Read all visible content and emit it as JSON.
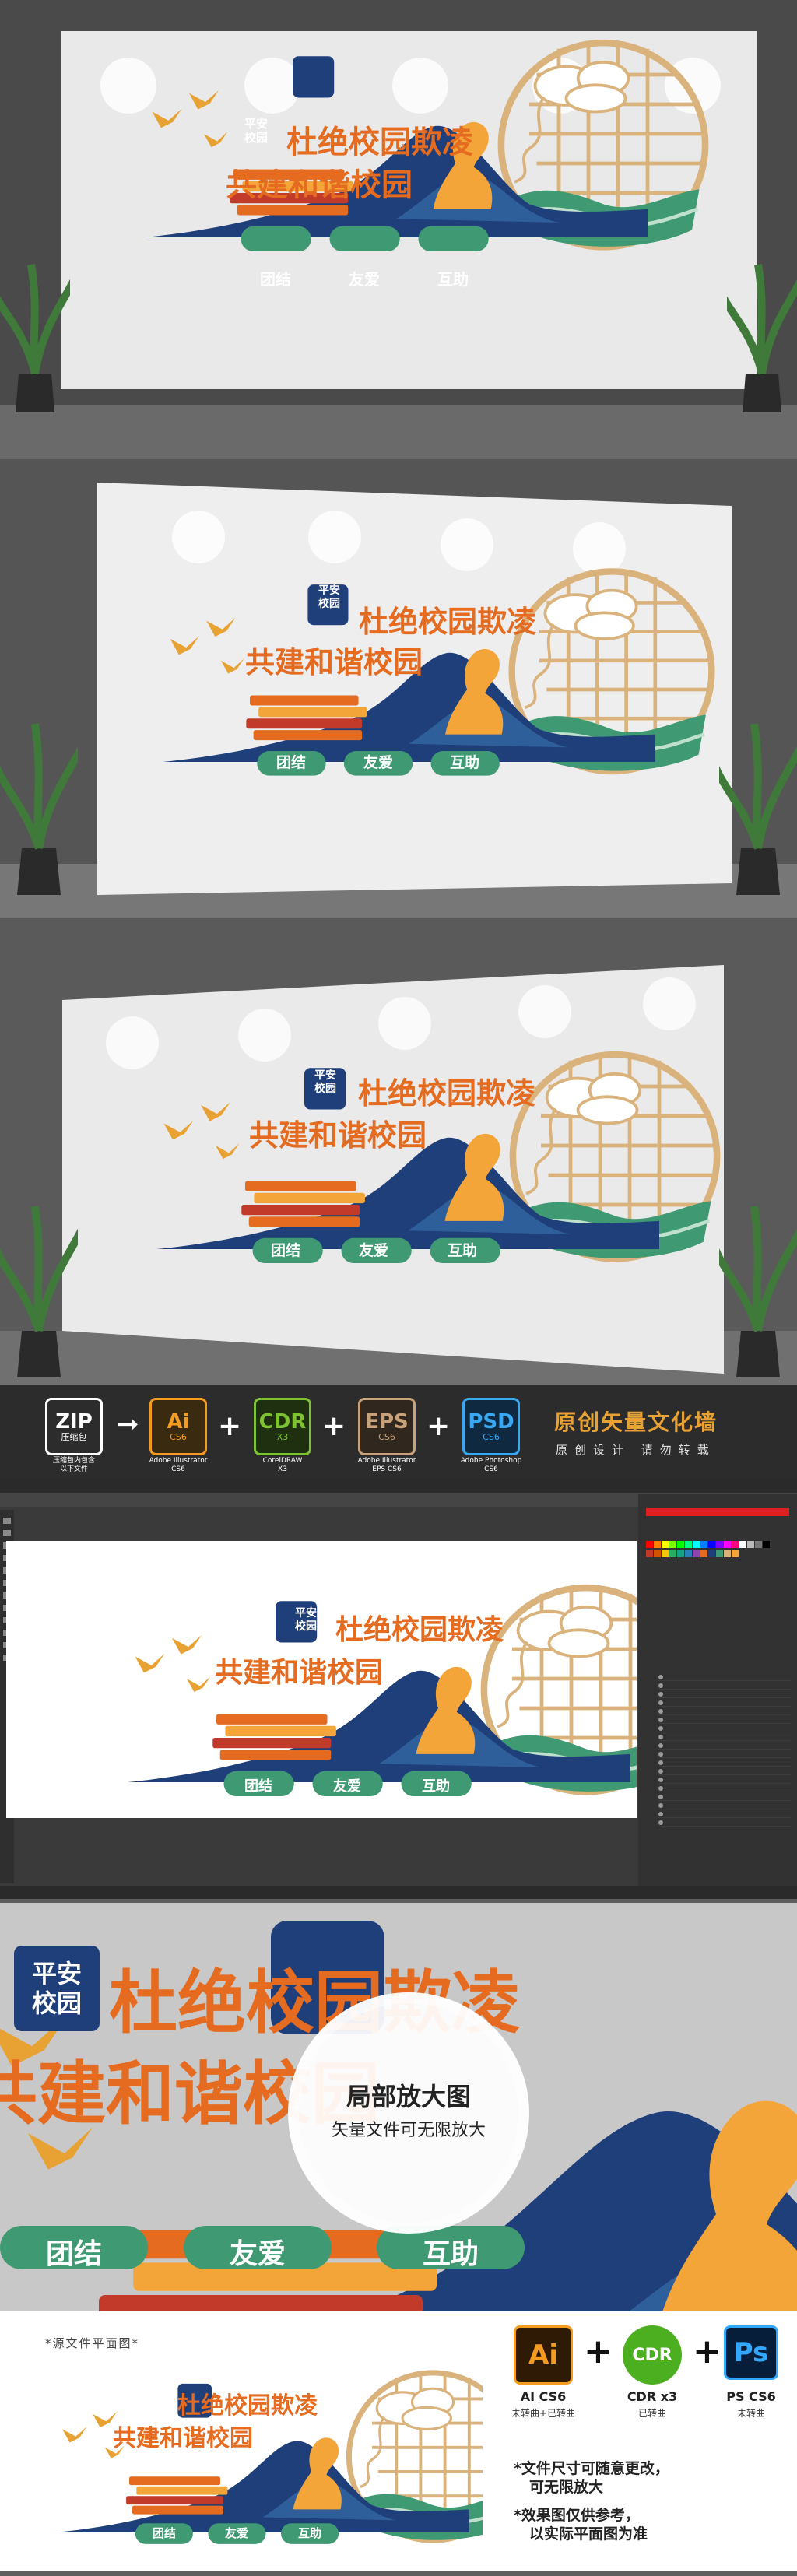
{
  "wall": {
    "badge_line1": "平安",
    "badge_line2": "校园",
    "title_line1": "杜绝校园欺凌",
    "title_line2": "共建和谐校园",
    "pills": [
      "团结",
      "友爱",
      "互助"
    ]
  },
  "colors": {
    "orange": "#e46b1f",
    "navy": "#1f3f7a",
    "green": "#3f9a74",
    "gold": "#d9b27c",
    "yellow": "#f4a53a"
  },
  "format_banner": {
    "zip_label": "ZIP",
    "zip_caption_1": "压缩包",
    "zip_caption_2": "压缩包内包含",
    "zip_caption_3": "以下文件",
    "formats": [
      {
        "main": "Ai",
        "sub": "CS6",
        "cap1": "Adobe Illustrator",
        "cap2": "CS6",
        "color": "#f39c1f"
      },
      {
        "main": "CDR",
        "sub": "X3",
        "cap1": "CorelDRAW",
        "cap2": "X3",
        "color": "#7ec232"
      },
      {
        "main": "EPS",
        "sub": "CS6",
        "cap1": "Adobe Illustrator",
        "cap2": "EPS CS6",
        "color": "#c8a27a"
      },
      {
        "main": "PSD",
        "sub": "CS6",
        "cap1": "Adobe Photoshop",
        "cap2": "CS6",
        "color": "#3aa7f2"
      }
    ],
    "title": "原创矢量文化墙",
    "subtitle": "原创设计 请勿转载"
  },
  "zoom": {
    "title": "局部放大图",
    "subtitle": "矢量文件可无限放大"
  },
  "bottom": {
    "label": "*源文件平面图*",
    "software": [
      {
        "main": "Ai",
        "name": "AI CS6",
        "note": "未转曲+已转曲"
      },
      {
        "main": "CDR",
        "name": "CDR x3",
        "note": "已转曲"
      },
      {
        "main": "Ps",
        "name": "PS CS6",
        "note": "未转曲"
      }
    ],
    "notes": [
      "*文件尺寸可随意更改，",
      "可无限放大",
      "*效果图仅供参考，",
      "以实际平面图为准"
    ]
  }
}
